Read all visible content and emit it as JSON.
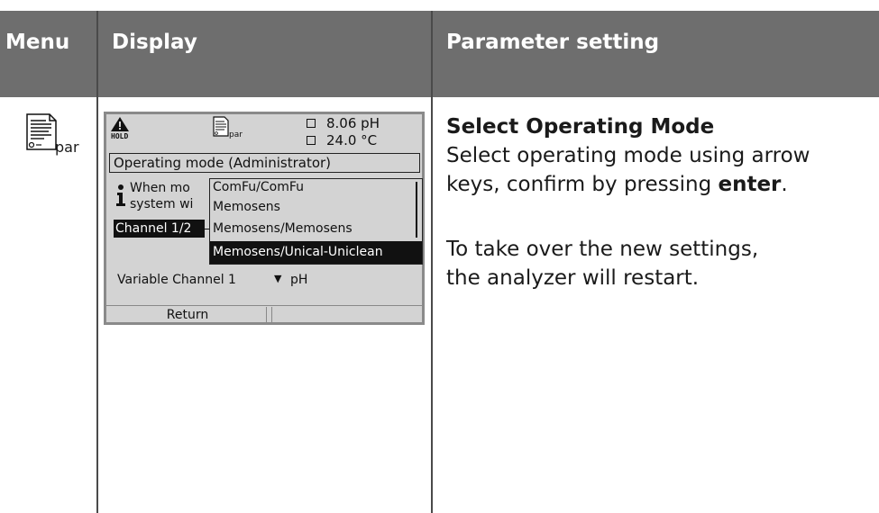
{
  "header": {
    "menu": "Menu",
    "display": "Display",
    "parameter": "Parameter setting"
  },
  "menu_icon": {
    "name": "par-document-icon",
    "label": "par"
  },
  "screen": {
    "hold": "HOLD",
    "icon_label": "par",
    "reading1": "8.06 pH",
    "reading2": "24.0 °C",
    "title": "Operating mode (Administrator)",
    "info_line1": "When mo",
    "info_line2": "system wi",
    "channel_label": "Channel 1/2",
    "dropdown": {
      "options": [
        "ComFu/ComFu",
        "Memosens",
        "Memosens/Memosens",
        "Memosens/Unical-Uniclean"
      ],
      "selected": "Memosens/Unical-Uniclean"
    },
    "variable_label": "Variable Channel 1",
    "variable_value": "pH",
    "softkey_left": "Return",
    "softkey_right": ""
  },
  "instructions": {
    "title": "Select Operating Mode",
    "line1": "Select operating mode using arrow",
    "line2_pre": "keys, confirm by pressing ",
    "line2_bold": "enter",
    "line2_post": ".",
    "line3": "To take over the new settings,",
    "line4": "the analyzer will restart."
  }
}
